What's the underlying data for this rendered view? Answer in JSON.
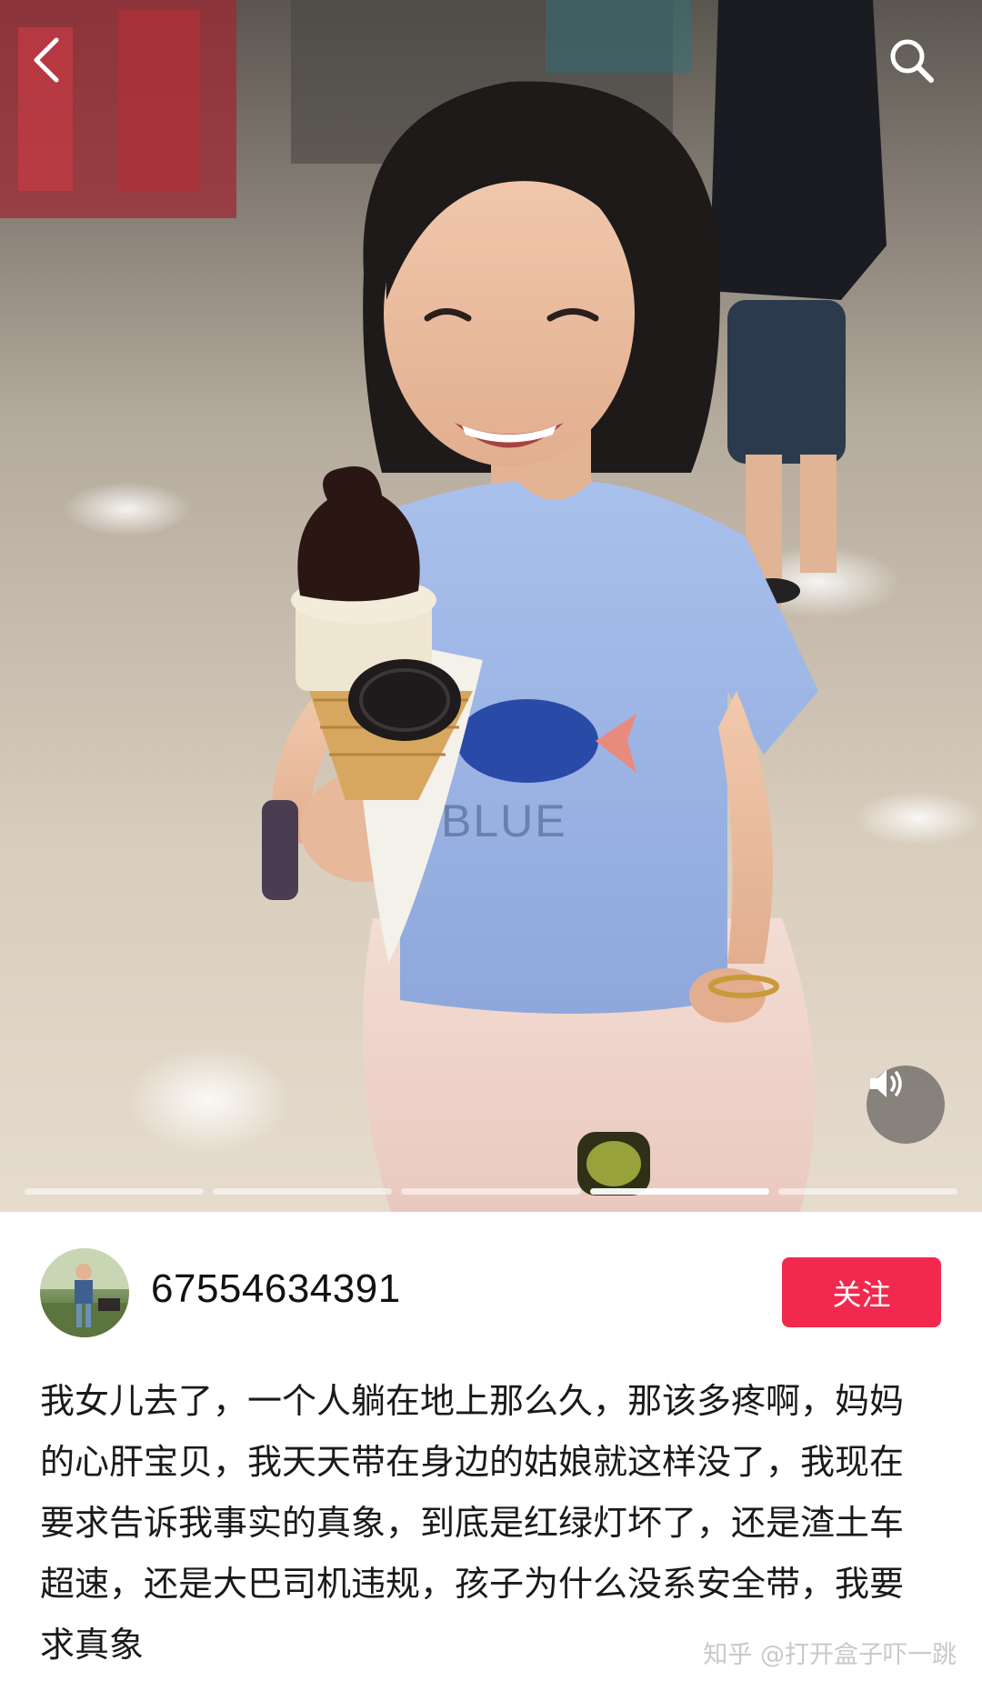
{
  "post": {
    "author_name": "67554634391",
    "follow_label": "关注",
    "caption": "我女儿去了，一个人躺在地上那么久，那该多疼啊，妈妈的心肝宝贝，我天天带在身边的姑娘就这样没了，我现在要求告诉我事实的真象，到底是红绿灯坏了，还是渣土车超速，还是大巴司机违规，孩子为什么没系安全带，我要求真象"
  },
  "photo": {
    "shirt_text": "BLUE",
    "description_icons": [
      "back-arrow-icon",
      "search-icon",
      "speaker-icon"
    ],
    "carousel": {
      "total": 5,
      "current": 4
    }
  },
  "watermark": "知乎 @打开盒子吓一跳",
  "colors": {
    "follow_button": "#f2294e",
    "caption_text": "#1a1a1a",
    "username_text": "#111111",
    "watermark_text": "#c9c9c9"
  }
}
